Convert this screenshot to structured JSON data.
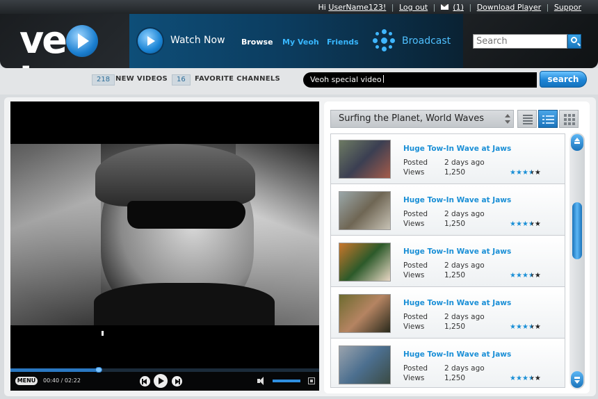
{
  "topbar": {
    "greeting": "Hi",
    "username": "UserName123!",
    "logout": "Log out",
    "messages": "(1)",
    "download_player": "Download Player",
    "support": "Suppor"
  },
  "header": {
    "logo_text_left": "ve",
    "logo_text_right": "h",
    "watch_now": "Watch Now",
    "browse": "Browse",
    "my_veoh": "My Veoh",
    "friends": "Friends",
    "broadcast": "Broadcast",
    "search_placeholder": "Search"
  },
  "subbar": {
    "new_videos_count": "218",
    "new_videos_label": "NEW VIDEOS",
    "favorite_count": "16",
    "favorite_label": "FAVORITE CHANNELS",
    "search_value": "Veoh special video",
    "search_button": "search"
  },
  "player": {
    "menu_label": "MENU",
    "time_current": "00:40",
    "time_separator": "/",
    "time_total": "02:22",
    "progress": 0.286,
    "volume": 1.0
  },
  "playlist": {
    "title": "Surfing the Planet, World Waves",
    "items": [
      {
        "title": "Huge Tow-In Wave at Jaws",
        "posted_label": "Posted",
        "posted": "2 days ago",
        "views_label": "Views",
        "views": "1,250",
        "rating": 3.5,
        "thumb_colors": [
          "#6d7a63",
          "#3b3f52",
          "#a45b4a"
        ]
      },
      {
        "title": "Huge Tow-In Wave at Jaws",
        "posted_label": "Posted",
        "posted": "2 days ago",
        "views_label": "Views",
        "views": "1,250",
        "rating": 3.5,
        "thumb_colors": [
          "#9aa7a9",
          "#6f6654",
          "#c7c2b5"
        ]
      },
      {
        "title": "Huge Tow-In Wave at Jaws",
        "posted_label": "Posted",
        "posted": "2 days ago",
        "views_label": "Views",
        "views": "1,250",
        "rating": 3.5,
        "thumb_colors": [
          "#c9762b",
          "#2c5a2a",
          "#e8d7c4"
        ]
      },
      {
        "title": "Huge Tow-In Wave at Jaws",
        "posted_label": "Posted",
        "posted": "2 days ago",
        "views_label": "Views",
        "views": "1,250",
        "rating": 3.5,
        "thumb_colors": [
          "#6d6b2f",
          "#b58462",
          "#2a2a1c"
        ]
      },
      {
        "title": "Huge Tow-In Wave at Jaws",
        "posted_label": "Posted",
        "posted": "2 days ago",
        "views_label": "Views",
        "views": "1,250",
        "rating": 3.5,
        "thumb_colors": [
          "#9aa3ad",
          "#4c6f8f",
          "#3b4b44"
        ]
      }
    ]
  },
  "colors": {
    "accent": "#1a8fd6",
    "header_dark": "#1a1d20",
    "nav_blue": "#0e4e78"
  },
  "icons": [
    "play-circle-icon",
    "broadcast-icon",
    "search-icon",
    "mail-icon",
    "speaker-icon",
    "fullscreen-icon",
    "prev-icon",
    "next-icon",
    "play-icon",
    "scroll-up-icon",
    "scroll-down-icon",
    "list-view-icon",
    "detail-view-icon",
    "grid-view-icon",
    "sort-arrows-icon",
    "star-icon"
  ]
}
